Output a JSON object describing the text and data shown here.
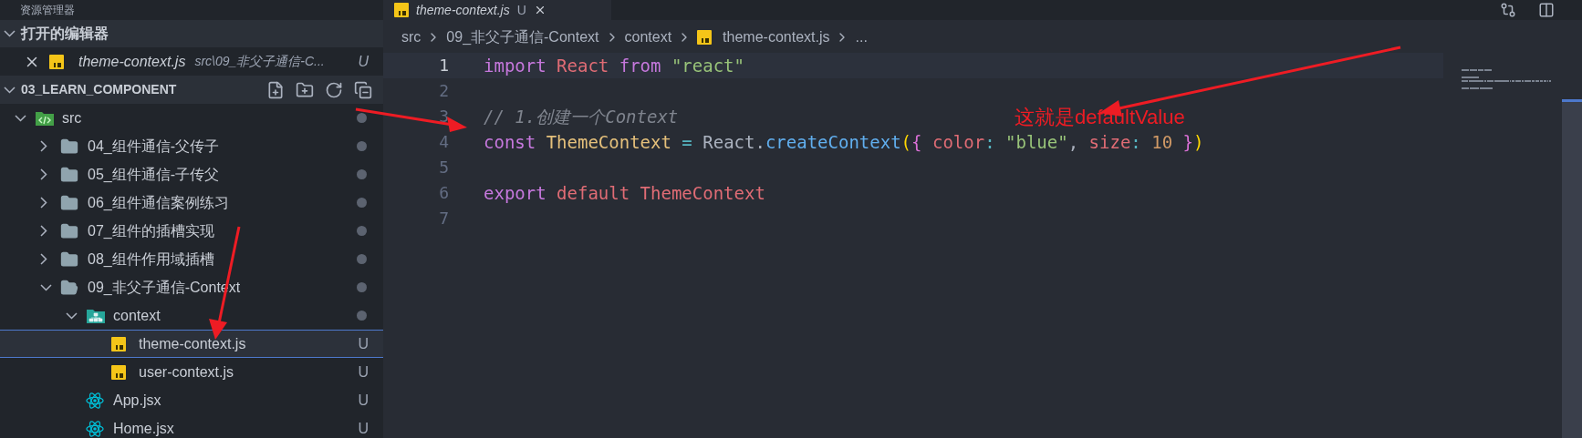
{
  "sidebar": {
    "title": "资源管理器",
    "open_editors": {
      "title": "打开的编辑器",
      "expanded": true,
      "items": [
        {
          "name": "theme-context.js",
          "path": "src\\09_非父子通信-C...",
          "status": "U"
        }
      ]
    },
    "project": {
      "title": "03_LEARN_COMPONENT",
      "expanded": true,
      "tree": [
        {
          "name": "src",
          "kind": "src-folder",
          "selected": false,
          "expanded": true,
          "modified_dot": true,
          "children": [
            {
              "name": "04_组件通信-父传子",
              "kind": "folder",
              "selected": false,
              "expanded": false,
              "modified_dot": true
            },
            {
              "name": "05_组件通信-子传父",
              "kind": "folder",
              "selected": false,
              "expanded": false,
              "modified_dot": true
            },
            {
              "name": "06_组件通信案例练习",
              "kind": "folder",
              "selected": false,
              "expanded": false,
              "modified_dot": true
            },
            {
              "name": "07_组件的插槽实现",
              "kind": "folder",
              "selected": false,
              "expanded": false,
              "modified_dot": true
            },
            {
              "name": "08_组件作用域插槽",
              "kind": "folder",
              "selected": false,
              "expanded": false,
              "modified_dot": true
            },
            {
              "name": "09_非父子通信-Context",
              "kind": "folder",
              "selected": false,
              "expanded": true,
              "modified_dot": true,
              "children": [
                {
                  "name": "context",
                  "kind": "context-folder",
                  "selected": false,
                  "expanded": true,
                  "modified_dot": true,
                  "children": [
                    {
                      "name": "theme-context.js",
                      "kind": "js",
                      "selected": true,
                      "status": "U"
                    },
                    {
                      "name": "user-context.js",
                      "kind": "js",
                      "selected": false,
                      "status": "U"
                    }
                  ]
                },
                {
                  "name": "App.jsx",
                  "kind": "react",
                  "selected": false,
                  "status": "U"
                },
                {
                  "name": "Home.jsx",
                  "kind": "react",
                  "selected": false,
                  "status": "U"
                }
              ]
            }
          ]
        }
      ]
    }
  },
  "editor": {
    "tab": {
      "title": "theme-context.js",
      "status": "U"
    },
    "breadcrumb": [
      {
        "label": "src",
        "kind": "text"
      },
      {
        "label": "09_非父子通信-Context",
        "kind": "text"
      },
      {
        "label": "context",
        "kind": "text"
      },
      {
        "label": "theme-context.js",
        "kind": "js"
      },
      {
        "label": "...",
        "kind": "text"
      }
    ],
    "lines": [
      {
        "number": "1",
        "selected": true,
        "tokens": [
          {
            "text": "import ",
            "kind": "keyword"
          },
          {
            "text": "React ",
            "kind": "variable"
          },
          {
            "text": "from ",
            "kind": "keyword"
          },
          {
            "text": "\"react\"",
            "kind": "string"
          }
        ]
      },
      {
        "number": "2",
        "selected": false
      },
      {
        "number": "3",
        "selected": false,
        "tokens": [
          {
            "text": "// 1.创建一个Context",
            "kind": "comment"
          }
        ]
      },
      {
        "number": "4",
        "selected": false,
        "tokens": [
          {
            "text": "const ",
            "kind": "keyword"
          },
          {
            "text": "ThemeContext ",
            "kind": "class"
          },
          {
            "text": "= ",
            "kind": "operator"
          },
          {
            "text": "React.",
            "kind": "plain"
          },
          {
            "text": "createContext",
            "kind": "function"
          },
          {
            "text": "(",
            "kind": "bracket1"
          },
          {
            "text": "{ ",
            "kind": "bracket2"
          },
          {
            "text": "color",
            "kind": "variable"
          },
          {
            "text": ": ",
            "kind": "operator"
          },
          {
            "text": "\"blue\"",
            "kind": "string"
          },
          {
            "text": ", ",
            "kind": "plain"
          },
          {
            "text": "size",
            "kind": "variable"
          },
          {
            "text": ": ",
            "kind": "operator"
          },
          {
            "text": "10 ",
            "kind": "number"
          },
          {
            "text": "}",
            "kind": "bracket2"
          },
          {
            "text": ")",
            "kind": "bracket1"
          }
        ]
      },
      {
        "number": "5",
        "selected": false
      },
      {
        "number": "6",
        "selected": false,
        "tokens": [
          {
            "text": "export ",
            "kind": "keyword"
          },
          {
            "text": "default ",
            "kind": "variable"
          },
          {
            "text": "ThemeContext",
            "kind": "variable"
          }
        ]
      },
      {
        "number": "7",
        "selected": false
      }
    ]
  },
  "annotation": {
    "text": "这就是defaultValue"
  }
}
